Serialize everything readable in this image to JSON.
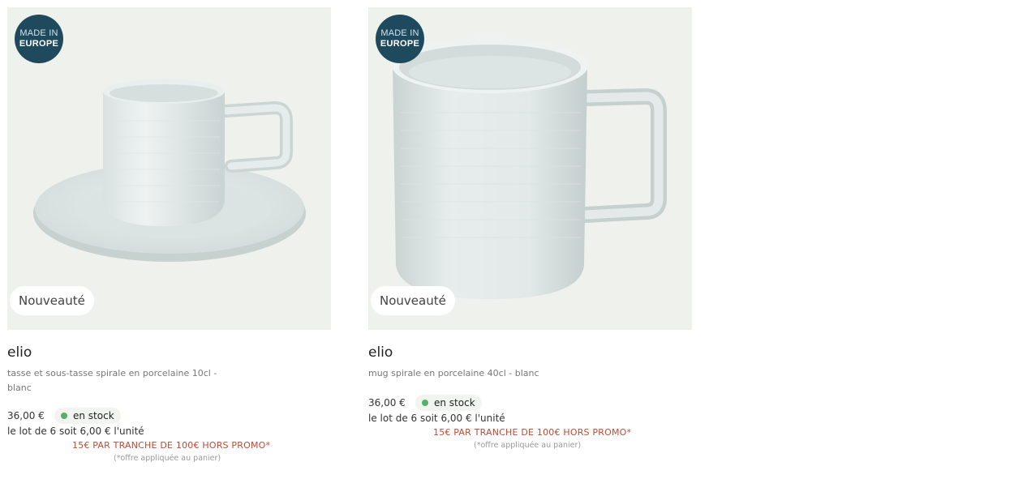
{
  "products": [
    {
      "origin_badge": {
        "line1": "MADE IN",
        "line2": "EUROPE"
      },
      "new_tag": "Nouveauté",
      "name": "elio",
      "description": "tasse et sous-tasse spirale en porcelaine 10cl - blanc",
      "price": "36,00 €",
      "stock": "en stock",
      "lot": "le lot de 6 soit 6,00 € l'unité",
      "promo": "15€ PAR TRANCHE DE 100€ HORS PROMO*",
      "promo_note": "(*offre appliquée au panier)",
      "image": "cup-and-saucer"
    },
    {
      "origin_badge": {
        "line1": "MADE IN",
        "line2": "EUROPE"
      },
      "new_tag": "Nouveauté",
      "name": "elio",
      "description": "mug spirale en porcelaine 40cl - blanc",
      "price": "36,00 €",
      "stock": "en stock",
      "lot": "le lot de 6 soit 6,00 € l'unité",
      "promo": "15€ PAR TRANCHE DE 100€ HORS PROMO*",
      "promo_note": "(*offre appliquée au panier)",
      "image": "mug"
    }
  ],
  "colors": {
    "badge_bg": "#1f4a5e",
    "promo": "#c04a34",
    "stock_dot": "#55b06a",
    "image_bg": "#eef1ec"
  }
}
